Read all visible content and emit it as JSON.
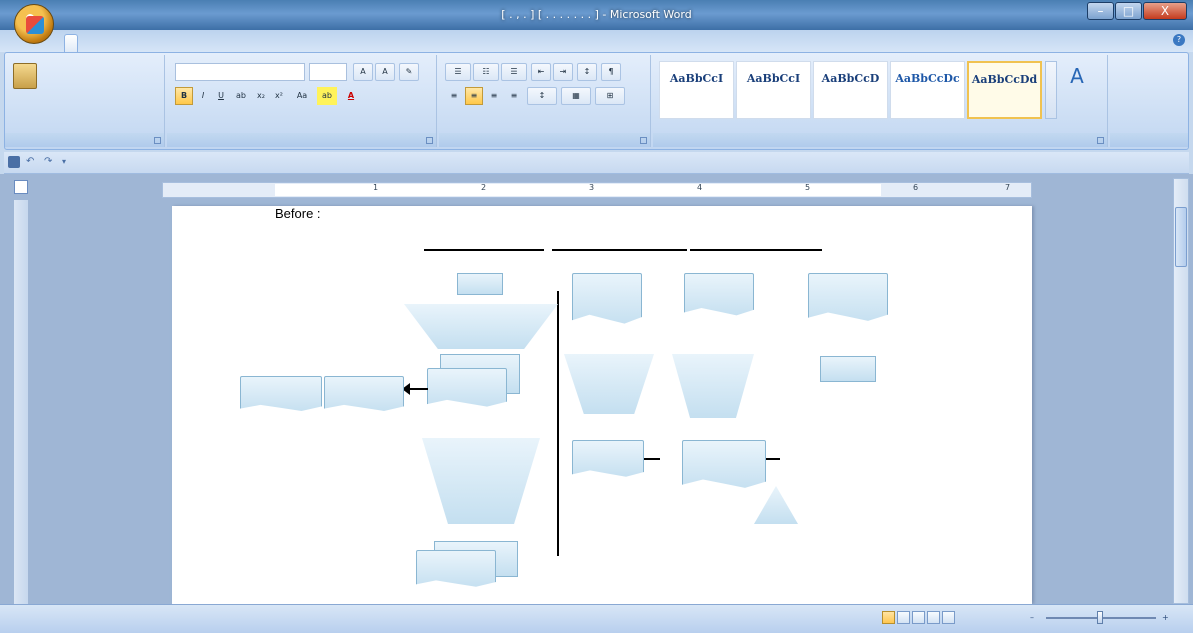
{
  "window": {
    "title": "[ . , . ] [ . . . . . . . ] - Microsoft Word",
    "minimize": "–",
    "maximize": "□",
    "close": "X"
  },
  "tabs": [
    {
      "label": "",
      "active": true
    },
    {
      "label": ""
    },
    {
      "label": ""
    },
    {
      "label": ""
    },
    {
      "label": ""
    },
    {
      "label": ""
    },
    {
      "label": ""
    },
    {
      "label": ""
    }
  ],
  "ribbon": {
    "clipboard": {
      "label": "",
      "paste": "",
      "cut": "",
      "copy": "",
      "format_painter": ""
    },
    "font": {
      "label": "",
      "font_name": "",
      "font_size": "",
      "bold": "B",
      "italic": "I",
      "underline": "U"
    },
    "paragraph": {
      "label": ""
    },
    "styles": {
      "label": "",
      "tiles": [
        {
          "sample": "AaBbCcI",
          "name": "",
          "selected": false
        },
        {
          "sample": "AaBbCcI",
          "name": "",
          "selected": false
        },
        {
          "sample": "AaBbCcD",
          "name": "",
          "selected": false
        },
        {
          "sample": "AaBbCcDc",
          "name": "",
          "selected": false
        },
        {
          "sample": "AaBbCcDd",
          "name": "",
          "selected": true
        }
      ],
      "change_styles": ""
    },
    "editing": {
      "label": "",
      "find": "",
      "replace": "",
      "select": ""
    }
  },
  "document": {
    "heading": "Before :",
    "columns": [
      "",
      "",
      "",
      "",
      ""
    ],
    "labels": {
      "box1": "",
      "trap1": "",
      "doc_left1": "",
      "rect_left2": "",
      "doc_center": "",
      "trap_big": "",
      "doc_bottom": "",
      "doc_c1": "",
      "doc_c2": "",
      "doc_c3": "",
      "trap_c1": "",
      "trap_c2": "",
      "rect_c4": "",
      "doc_c5": "",
      "doc_c6": "",
      "tri": ""
    }
  },
  "statusbar": {
    "page": "",
    "words": "",
    "language": "",
    "zoom": ""
  },
  "colors": {
    "accent": "#15428b",
    "ribbon_bg": "#cfe0f5",
    "shape_fill": "#c4dff0",
    "selected_style": "#f0c250"
  }
}
